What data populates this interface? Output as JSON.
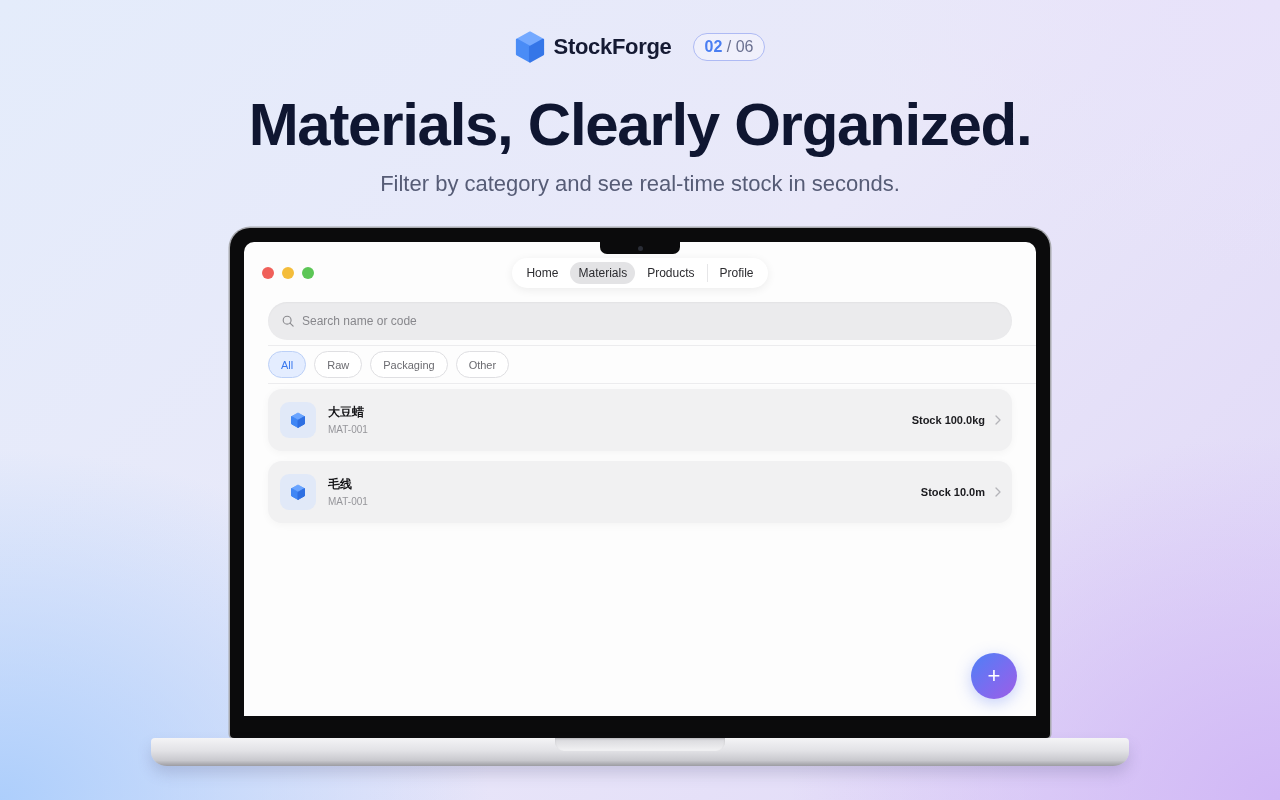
{
  "header": {
    "brand": "StockForge",
    "page_current": "02",
    "page_separator": "/",
    "page_total": "06"
  },
  "headline": "Materials, Clearly Organized.",
  "subtitle": "Filter by category and see real-time stock in seconds.",
  "app": {
    "tabs": [
      {
        "label": "Home",
        "selected": false
      },
      {
        "label": "Materials",
        "selected": true
      },
      {
        "label": "Products",
        "selected": false
      },
      {
        "label": "Profile",
        "selected": false
      }
    ],
    "search": {
      "placeholder": "Search name or code"
    },
    "filters": [
      {
        "label": "All",
        "selected": true
      },
      {
        "label": "Raw",
        "selected": false
      },
      {
        "label": "Packaging",
        "selected": false
      },
      {
        "label": "Other",
        "selected": false
      }
    ],
    "materials": [
      {
        "name": "大豆蜡",
        "code": "MAT-001",
        "stock": "Stock 100.0kg"
      },
      {
        "name": "毛线",
        "code": "MAT-001",
        "stock": "Stock 10.0m"
      }
    ],
    "fab": {
      "label": "+"
    }
  }
}
